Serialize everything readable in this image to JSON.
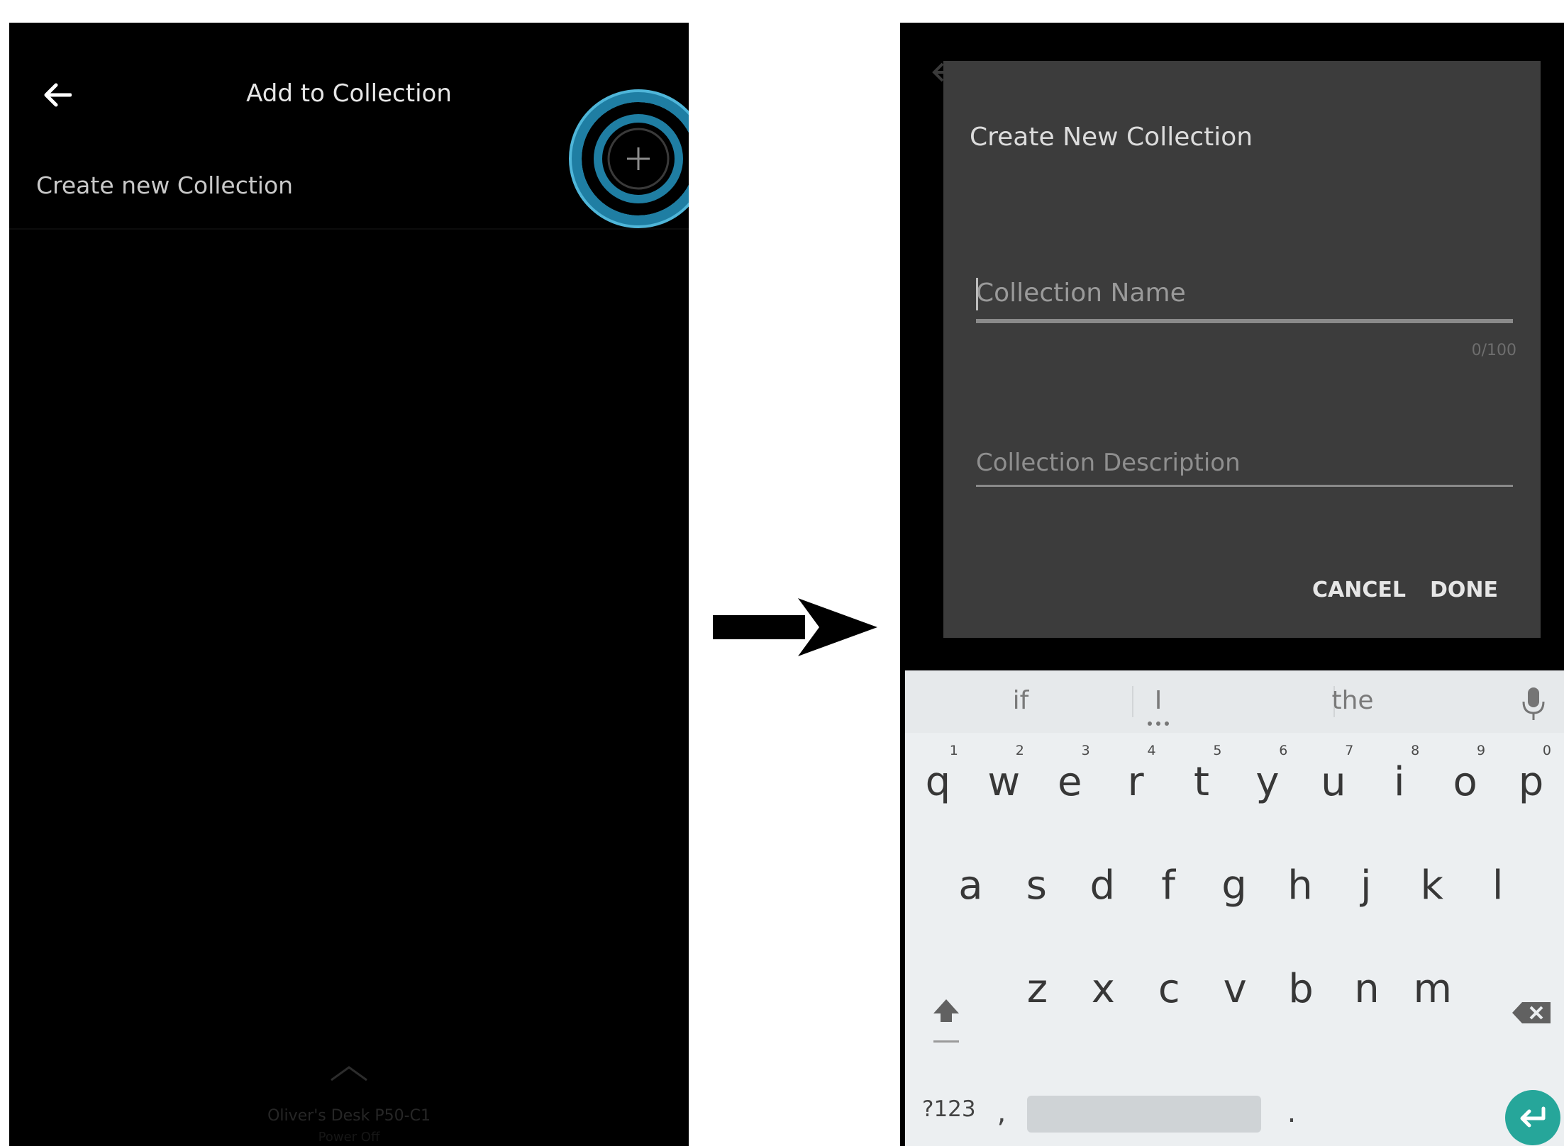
{
  "left_screen": {
    "header_title": "Add to Collection",
    "create_row_label": "Create new Collection",
    "device_name": "Oliver's Desk P50-C1",
    "device_status": "Power Off"
  },
  "right_screen": {
    "dialog": {
      "title": "Create New Collection",
      "name_placeholder": "Collection Name",
      "name_counter": "0/100",
      "description_placeholder": "Collection Description",
      "cancel_label": "CANCEL",
      "done_label": "DONE"
    },
    "keyboard": {
      "suggestions": [
        "if",
        "I",
        "the"
      ],
      "row1": [
        {
          "key": "q",
          "hint": "1"
        },
        {
          "key": "w",
          "hint": "2"
        },
        {
          "key": "e",
          "hint": "3"
        },
        {
          "key": "r",
          "hint": "4"
        },
        {
          "key": "t",
          "hint": "5"
        },
        {
          "key": "y",
          "hint": "6"
        },
        {
          "key": "u",
          "hint": "7"
        },
        {
          "key": "i",
          "hint": "8"
        },
        {
          "key": "o",
          "hint": "9"
        },
        {
          "key": "p",
          "hint": "0"
        }
      ],
      "row2": [
        "a",
        "s",
        "d",
        "f",
        "g",
        "h",
        "j",
        "k",
        "l"
      ],
      "row3": [
        "z",
        "x",
        "c",
        "v",
        "b",
        "n",
        "m"
      ],
      "symbols_label": "?123",
      "comma_label": ",",
      "period_label": "."
    }
  },
  "colors": {
    "highlight_ring": "#1f7ea3",
    "highlight_ring_light": "#4fb6d9",
    "dialog_bg": "#3c3c3c",
    "keyboard_bg": "#eceff1",
    "enter_key": "#26a69a"
  },
  "icons": {
    "left_back": "arrow-left-icon",
    "add": "plus-circle-icon",
    "arrow": "arrow-right-icon",
    "mic": "microphone-icon",
    "shift": "shift-icon",
    "backspace": "backspace-icon",
    "enter": "enter-icon"
  }
}
